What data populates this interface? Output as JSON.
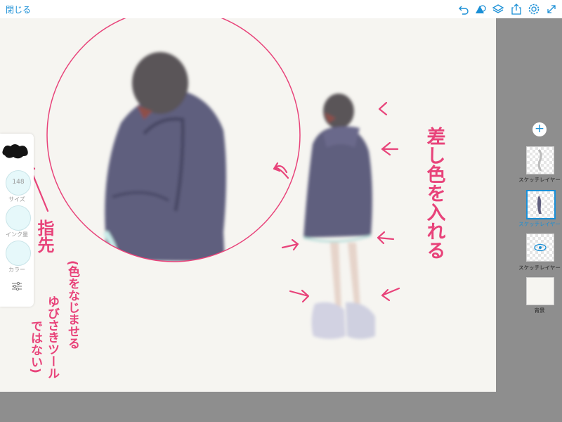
{
  "topbar": {
    "close_label": "閉じる",
    "icons": [
      "undo-icon",
      "shapes-icon",
      "layers-icon",
      "share-icon",
      "settings-icon",
      "expand-icon"
    ]
  },
  "toolpanel": {
    "size_value": "148",
    "size_label": "サイズ",
    "ink_label": "インク量",
    "color_label": "カラー"
  },
  "layers": {
    "items": [
      {
        "label": "スケッチレイヤー",
        "selected": false
      },
      {
        "label": "スケッチレイヤー",
        "selected": true
      },
      {
        "label": "スケッチレイヤー",
        "selected": false
      },
      {
        "label": "背景",
        "selected": false
      }
    ]
  },
  "annotations": {
    "right_text": "差し色を入れる",
    "left_text_1": "指先",
    "left_text_2": "(色をなじませる",
    "left_text_3": "ゆびさきツール",
    "left_text_4": "ではない)"
  },
  "colors": {
    "accent": "#1a8fd6",
    "annotation": "#e8437a",
    "canvas": "#f6f5f1",
    "panel_gray": "#8e8e8e",
    "coat": "#5f5e7e"
  }
}
